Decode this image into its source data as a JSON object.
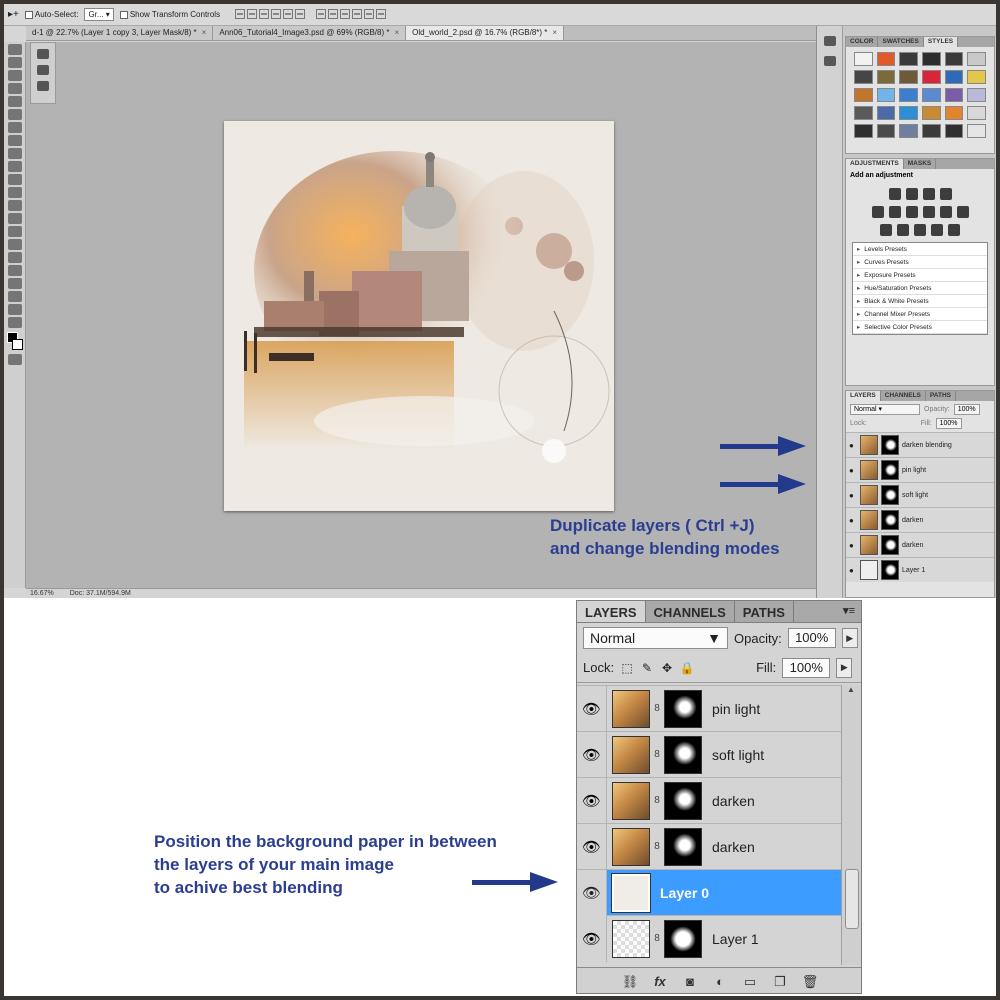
{
  "options_bar": {
    "auto_select_label": "Auto-Select:",
    "auto_select_value": "Gr...",
    "show_transform_label": "Show Transform Controls"
  },
  "doc_tabs": [
    {
      "label": "d-1 @ 22.7% (Layer 1 copy 3, Layer Mask/8) *",
      "close": "×"
    },
    {
      "label": "Ann06_Tutorial4_Image3.psd @ 69% (RGB/8) *",
      "close": "×"
    },
    {
      "label": "Old_world_2.psd @ 16.7% (RGB/8*) *",
      "close": "×"
    }
  ],
  "status_bar": {
    "zoom": "16.67%",
    "doc_size": "Doc: 37.1M/594.9M"
  },
  "styles_panel": {
    "tabs": [
      "COLOR",
      "SWATCHES",
      "STYLES"
    ],
    "active_tab": "STYLES",
    "swatch_colors": [
      "#f2f2f2",
      "#e05a2a",
      "#3a3a3a",
      "#2d2d2d",
      "#3a3a3a",
      "#c9c9c9",
      "#454545",
      "#7a6a3c",
      "#6d5a3b",
      "#d8253a",
      "#2e6ab8",
      "#e3c64a",
      "#c0742c",
      "#74b3e8",
      "#3c7fd0",
      "#5b8ad0",
      "#7a5ca8",
      "#b9b9d9",
      "#5a5a5a",
      "#4d6aa8",
      "#2b8fd8",
      "#c88a32",
      "#e0852e",
      "#d8d8d8",
      "#2f2f2f",
      "#4a4a4a",
      "#6f7f9f",
      "#3b3b3b",
      "#2f2f2f",
      "#e5e5e5"
    ]
  },
  "adjustments_panel": {
    "tabs": [
      "ADJUSTMENTS",
      "MASKS"
    ],
    "title": "Add an adjustment",
    "presets": [
      "Levels Presets",
      "Curves Presets",
      "Exposure Presets",
      "Hue/Saturation Presets",
      "Black & White Presets",
      "Channel Mixer Presets",
      "Selective Color Presets"
    ]
  },
  "small_layers": {
    "tabs": [
      "LAYERS",
      "CHANNELS",
      "PATHS"
    ],
    "blend_mode": "Normal",
    "opacity_label": "Opacity:",
    "opacity": "100%",
    "lock_label": "Lock:",
    "fill_label": "Fill:",
    "fill": "100%",
    "layers": [
      {
        "name": "darken blending"
      },
      {
        "name": "pin light"
      },
      {
        "name": "soft light"
      },
      {
        "name": "darken"
      },
      {
        "name": "darken"
      },
      {
        "name": "Layer 1"
      }
    ]
  },
  "note_top": {
    "line1": "Duplicate layers  ( Ctrl +J)",
    "line2": "and change blending modes"
  },
  "big_layers": {
    "tabs": [
      "LAYERS",
      "CHANNELS",
      "PATHS"
    ],
    "menu_glyph": "▾≡",
    "blend_mode": "Normal",
    "opacity_label": "Opacity:",
    "opacity": "100%",
    "lock_label": "Lock:",
    "fill_label": "Fill:",
    "fill": "100%",
    "eye": "👁",
    "chain": "8",
    "layers": [
      {
        "name": "pin light",
        "selected": false
      },
      {
        "name": "soft light",
        "selected": false
      },
      {
        "name": "darken",
        "selected": false
      },
      {
        "name": "darken",
        "selected": false
      },
      {
        "name": "Layer 0",
        "selected": true
      },
      {
        "name": "Layer 1",
        "selected": false
      }
    ],
    "footer_icons": [
      "link-icon",
      "fx-icon",
      "mask-icon",
      "adjustment-icon",
      "folder-icon",
      "new-layer-icon",
      "trash-icon"
    ],
    "footer_fx": "fx"
  },
  "note_bottom": {
    "line1": "Position the background paper in between",
    "line2": "the layers of your main image",
    "line3": "to achive best blending"
  },
  "colors": {
    "arrow": "#233a8c",
    "note_text": "#2b3e92",
    "selected_layer": "#3c9cff"
  }
}
